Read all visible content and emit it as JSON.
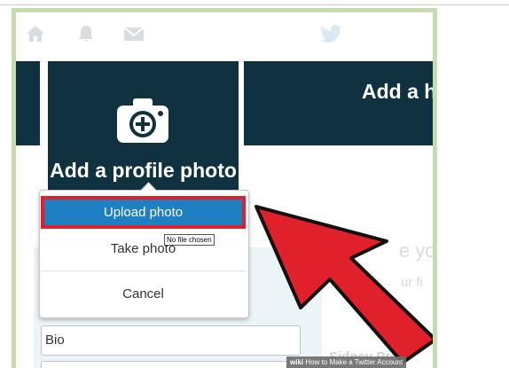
{
  "nav": {
    "icons": [
      "home-icon",
      "bell-icon",
      "mail-icon",
      "twitter-bird-icon"
    ]
  },
  "profile_tile": {
    "label": "Add a profile photo"
  },
  "header_tile": {
    "label": "Add a h"
  },
  "background_text": {
    "partial_heading": "e yo",
    "partial_line": "ur fi",
    "partial_name": "Sidney Pres"
  },
  "form": {
    "bio_placeholder": "Bio"
  },
  "menu": {
    "upload_label": "Upload photo",
    "take_label": "Take photo",
    "cancel_label": "Cancel"
  },
  "tooltip": {
    "text": "No file chosen"
  },
  "watermark": {
    "brand": "wiki",
    "caption": "How to Make a Twitter Account"
  },
  "colors": {
    "banner": "#0f3140",
    "frame_border": "#c7dcae",
    "upload_blue": "#1e7fc2",
    "highlight_red": "#e0202a"
  }
}
